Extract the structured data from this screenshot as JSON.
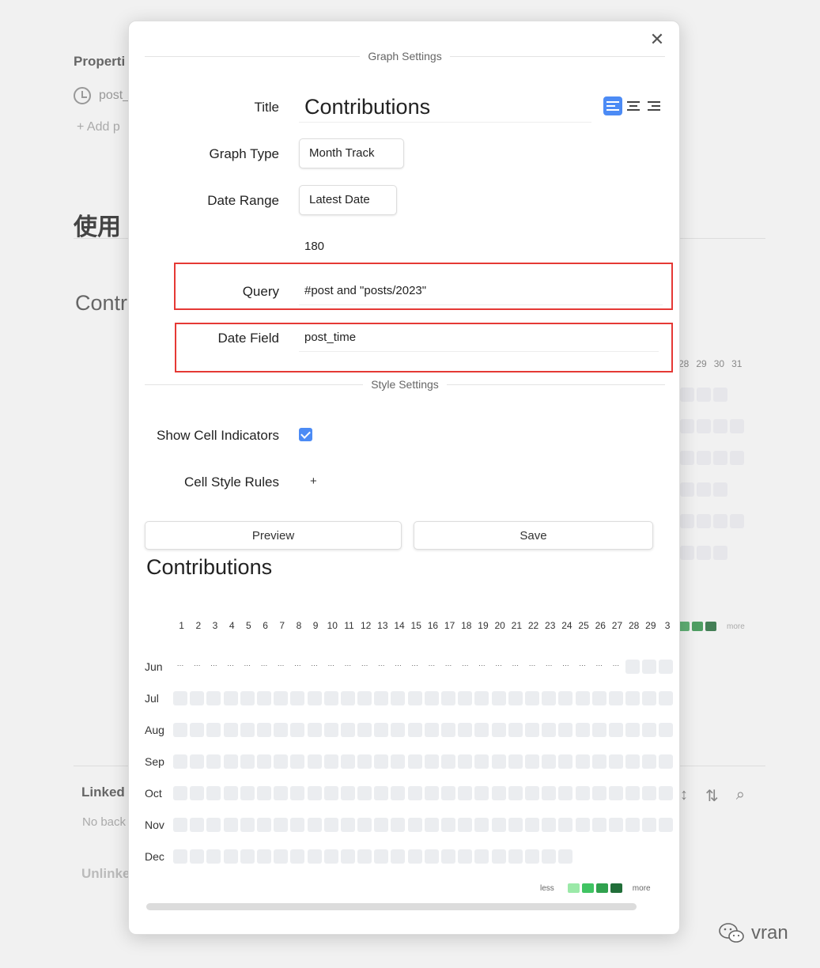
{
  "background": {
    "properties_label": "Properti",
    "property_name": "post_",
    "add_property": "+ Add p",
    "heading": "使用",
    "contributions_cut": "Contr",
    "day_numbers": [
      "28",
      "29",
      "30",
      "31"
    ],
    "linked_label": "Linked",
    "no_backlinks": "No back",
    "unlinked_label": "Unlinke",
    "legend_more": "more",
    "watermark": "vran"
  },
  "modal": {
    "close_symbol": "✕",
    "graph_settings_title": "Graph Settings",
    "title_label": "Title",
    "title_value": "Contributions",
    "graph_type_label": "Graph Type",
    "graph_type_value": "Month Track",
    "date_range_label": "Date Range",
    "date_range_value": "Latest Date",
    "date_range_days": "180",
    "query_label": "Query",
    "query_value": "#post and \"posts/2023\"",
    "date_field_label": "Date Field",
    "date_field_value": "post_time",
    "style_settings_title": "Style Settings",
    "show_cell_indicators_label": "Show Cell Indicators",
    "show_cell_indicators_checked": true,
    "cell_style_rules_label": "Cell Style Rules",
    "add_rule_symbol": "+",
    "preview_button": "Preview",
    "save_button": "Save",
    "accent_color": "#4c8bf5",
    "highlight_color": "#e53935"
  },
  "preview": {
    "title": "Contributions",
    "days": [
      "1",
      "2",
      "3",
      "4",
      "5",
      "6",
      "7",
      "8",
      "9",
      "10",
      "11",
      "12",
      "13",
      "14",
      "15",
      "16",
      "17",
      "18",
      "19",
      "20",
      "21",
      "22",
      "23",
      "24",
      "25",
      "26",
      "27",
      "28",
      "29",
      "3"
    ],
    "months": [
      {
        "label": "Jun",
        "placeholder_days": 27,
        "cells": 3
      },
      {
        "label": "Jul",
        "placeholder_days": 0,
        "cells": 30
      },
      {
        "label": "Aug",
        "placeholder_days": 0,
        "cells": 30
      },
      {
        "label": "Sep",
        "placeholder_days": 0,
        "cells": 30
      },
      {
        "label": "Oct",
        "placeholder_days": 0,
        "cells": 30
      },
      {
        "label": "Nov",
        "placeholder_days": 0,
        "cells": 30
      },
      {
        "label": "Dec",
        "placeholder_days": 0,
        "cells": 24
      }
    ],
    "empty_cell_color": "#ebedf0",
    "legend": {
      "less": "less",
      "more": "more",
      "colors": [
        "#9be9a8",
        "#40c463",
        "#30a14e",
        "#216e39"
      ]
    }
  }
}
